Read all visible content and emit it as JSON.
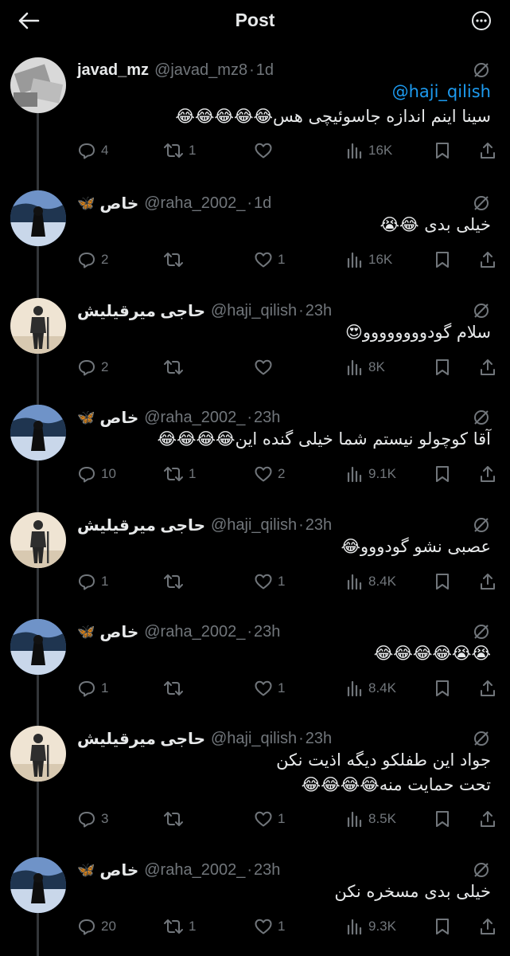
{
  "header": {
    "title": "Post"
  },
  "replies": [
    {
      "name": "javad_mz",
      "badge": "",
      "handle": "@javad_mz8",
      "time": "1d",
      "mention": "@haji_qilish",
      "text": "سینا اینم اندازه جاسوئیچی هس😂😂😂😂😂",
      "text2": "",
      "replies_count": "4",
      "reposts": "1",
      "likes": "",
      "views": "16K",
      "avatar": "javad"
    },
    {
      "name": "خاص",
      "badge": "🦋",
      "handle": "@raha_2002_",
      "time": "1d",
      "mention": "",
      "text": "خیلی بدی 😂😭",
      "text2": "",
      "replies_count": "2",
      "reposts": "",
      "likes": "1",
      "views": "16K",
      "avatar": "raha"
    },
    {
      "name": "حاجی میرقیلیش",
      "badge": "",
      "handle": "@haji_qilish",
      "time": "23h",
      "mention": "",
      "text": "سلام گودوووووووو😍",
      "text2": "",
      "replies_count": "2",
      "reposts": "",
      "likes": "",
      "views": "8K",
      "avatar": "haji"
    },
    {
      "name": "خاص",
      "badge": "🦋",
      "handle": "@raha_2002_",
      "time": "23h",
      "mention": "",
      "text": "آقا کوچولو نیستم شما خیلی گنده این😂😂😂😂",
      "text2": "",
      "replies_count": "10",
      "reposts": "1",
      "likes": "2",
      "views": "9.1K",
      "avatar": "raha"
    },
    {
      "name": "حاجی میرقیلیش",
      "badge": "",
      "handle": "@haji_qilish",
      "time": "23h",
      "mention": "",
      "text": "عصبی نشو گودووو😂",
      "text2": "",
      "replies_count": "1",
      "reposts": "",
      "likes": "1",
      "views": "8.4K",
      "avatar": "haji"
    },
    {
      "name": "خاص",
      "badge": "🦋",
      "handle": "@raha_2002_",
      "time": "23h",
      "mention": "",
      "text": "😭😭😂😂😂😂",
      "text2": "",
      "replies_count": "1",
      "reposts": "",
      "likes": "1",
      "views": "8.4K",
      "avatar": "raha"
    },
    {
      "name": "حاجی میرقیلیش",
      "badge": "",
      "handle": "@haji_qilish",
      "time": "23h",
      "mention": "",
      "text": "جواد این طفلکو دیگه اذیت نکن",
      "text2": "تحت حمایت منه😂😂😂😂",
      "replies_count": "3",
      "reposts": "",
      "likes": "1",
      "views": "8.5K",
      "avatar": "haji"
    },
    {
      "name": "خاص",
      "badge": "🦋",
      "handle": "@raha_2002_",
      "time": "23h",
      "mention": "",
      "text": "خیلی بدی مسخره نکن",
      "text2": "",
      "replies_count": "20",
      "reposts": "1",
      "likes": "1",
      "views": "9.3K",
      "avatar": "raha"
    }
  ],
  "colors": {
    "background": "#000000",
    "text": "#e7e9ea",
    "muted": "#71767b",
    "link": "#1d9bf0",
    "divider": "#333639"
  },
  "icons": [
    "back-arrow-icon",
    "more-icon",
    "grok-icon",
    "reply-icon",
    "repost-icon",
    "like-icon",
    "views-icon",
    "bookmark-icon",
    "share-icon"
  ]
}
